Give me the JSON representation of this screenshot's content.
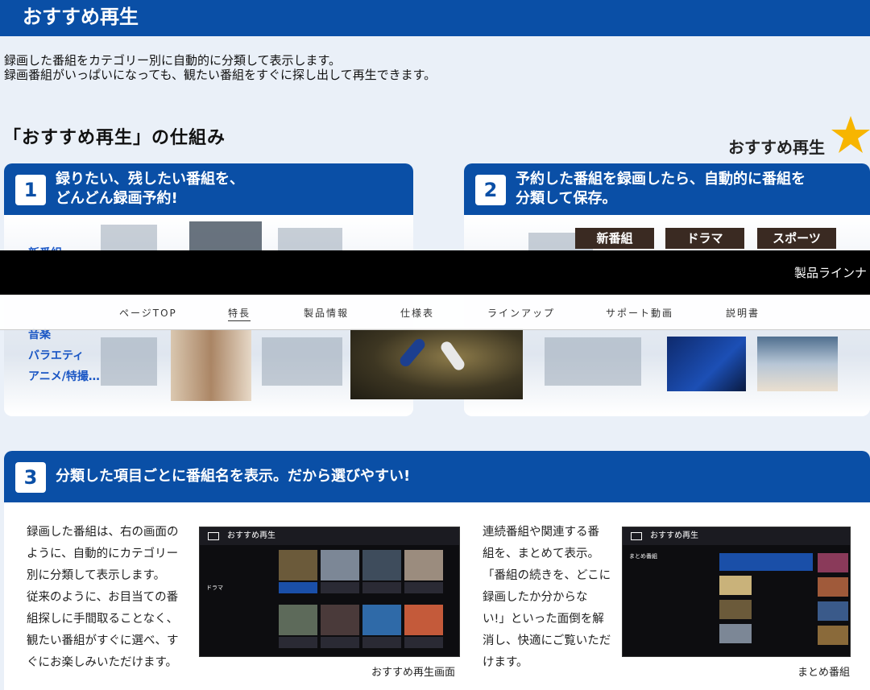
{
  "header": {
    "title": "おすすめ再生"
  },
  "intro": {
    "line1": "録画した番組をカテゴリー別に自動的に分類して表示します。",
    "line2": "録画番組がいっぱいになっても、観たい番組をすぐに探し出して再生できます。"
  },
  "section": {
    "title": "「おすすめ再生」の仕組み",
    "logo_text": "おすすめ再生"
  },
  "steps": [
    {
      "number": "1",
      "line1": "録りたい、残したい番組を、",
      "line2": "どんどん録画予約!"
    },
    {
      "number": "2",
      "line1": "予約した番組を録画したら、自動的に番組を",
      "line2": "分類して保存。"
    },
    {
      "number": "3",
      "line1": "分類した項目ごとに番組名を表示。だから選びやすい!"
    }
  ],
  "card1": {
    "genre_top": "新番組",
    "genres": [
      "音楽",
      "バラエティ",
      "アニメ/特撮…"
    ]
  },
  "card2": {
    "categories": [
      "新番組",
      "ドラマ",
      "スポーツ"
    ]
  },
  "overlay": {
    "right_text": "製品ラインナ"
  },
  "nav": {
    "items": [
      "ページTOP",
      "特長",
      "製品情報",
      "仕様表",
      "ラインアップ",
      "サポート動画",
      "説明書"
    ],
    "active_index": 1
  },
  "card3": {
    "left_text": [
      "録画した番組は、右の画面の",
      "ように、自動的にカテゴリー",
      "別に分類して表示します。",
      "従来のように、お目当ての番",
      "組探しに手間取ることなく、",
      "観たい番組がすぐに選べ、す",
      "ぐにお楽しみいただけます。"
    ],
    "screen1_title": "おすすめ再生",
    "screen1_caption": "おすすめ再生画面",
    "screen1_side": [
      "ドラマ"
    ],
    "right_text": [
      "連続番組や関連する番",
      "組を、まとめて表示。",
      "「番組の続きを、どこに",
      "録画したか分からな",
      "い!」といった面倒を解",
      "消し、快適にご覧いただ",
      "けます。"
    ],
    "screen2_title": "おすすめ再生",
    "screen2_caption": "まとめ番組",
    "screen2_side": [
      "まとめ番組"
    ]
  },
  "colors": {
    "primary": "#0a4fa6",
    "genre_blue": "#1a56c4",
    "label_brown": "#3a2a22",
    "star": "#f7b500"
  },
  "icons": {
    "star": "star-icon",
    "tv": "tv-icon"
  }
}
